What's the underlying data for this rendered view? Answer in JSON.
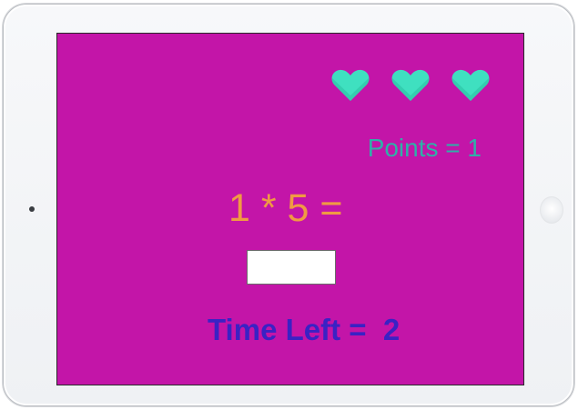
{
  "game": {
    "points_text": "Points = 1",
    "question_text": "1 * 5 =",
    "answer_value": "",
    "timer_text": "Time Left =  2",
    "lives": [
      {
        "icon": "heart-icon",
        "color": "#3fe0c0"
      },
      {
        "icon": "heart-icon",
        "color": "#3fe0c0"
      },
      {
        "icon": "heart-icon",
        "color": "#3fe0c0"
      }
    ]
  },
  "colors": {
    "screen_background": "#c315a8",
    "heart": "#3fe0c0",
    "points": "#2fb0a8",
    "question": "#f09a43",
    "timer": "#3a22c4"
  }
}
